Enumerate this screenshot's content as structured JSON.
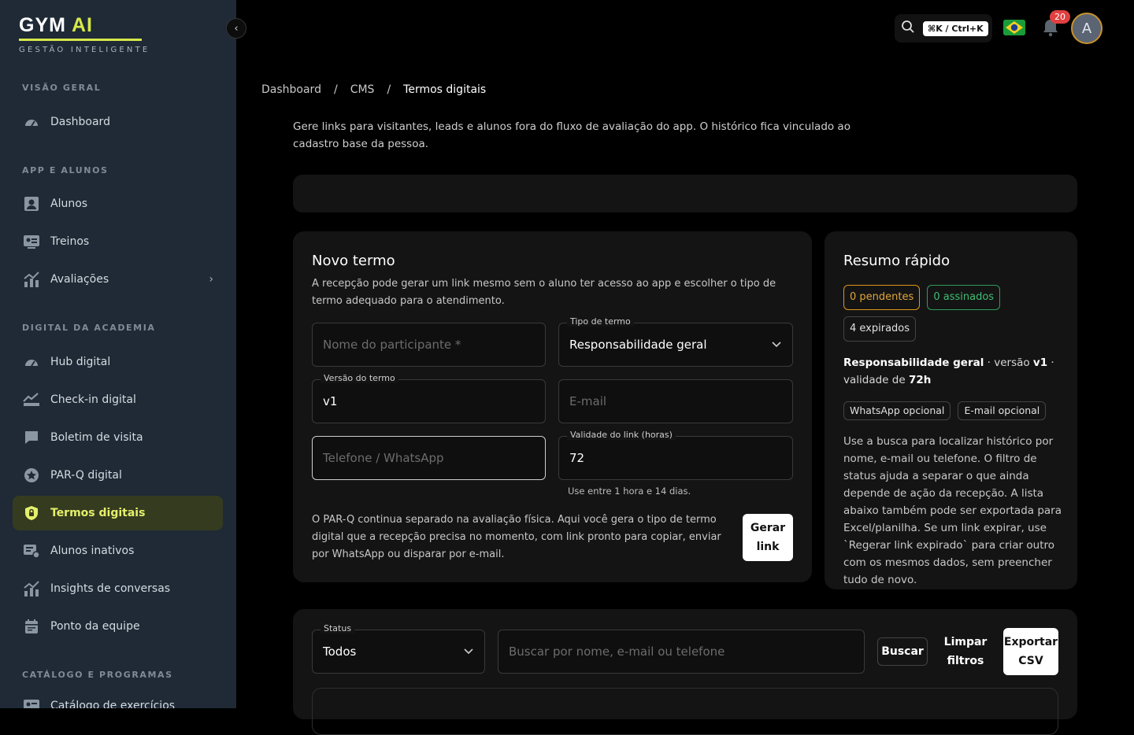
{
  "brand": {
    "name_main": "GYM",
    "name_accent": "AI",
    "tagline": "GESTÃO INTELIGENTE"
  },
  "sidebar": {
    "sections": [
      {
        "label": "VISÃO GERAL"
      },
      {
        "label": "APP E ALUNOS"
      },
      {
        "label": "DIGITAL DA ACADEMIA"
      },
      {
        "label": "CATÁLOGO E PROGRAMAS"
      }
    ],
    "items": [
      {
        "label": "Dashboard",
        "icon": "gauge-icon"
      },
      {
        "label": "Alunos",
        "icon": "user-icon"
      },
      {
        "label": "Treinos",
        "icon": "id-card-icon"
      },
      {
        "label": "Avaliações",
        "icon": "chart-icon"
      },
      {
        "label": "Hub digital",
        "icon": "gauge-icon"
      },
      {
        "label": "Check-in digital",
        "icon": "check-in-icon"
      },
      {
        "label": "Boletim de visita",
        "icon": "message-icon"
      },
      {
        "label": "PAR-Q digital",
        "icon": "star-badge-icon"
      },
      {
        "label": "Termos digitais",
        "icon": "lock-icon"
      },
      {
        "label": "Alunos inativos",
        "icon": "user-inactive-icon"
      },
      {
        "label": "Insights de conversas",
        "icon": "chart-icon"
      },
      {
        "label": "Ponto da equipe",
        "icon": "calendar-icon"
      },
      {
        "label": "Catálogo de exercícios",
        "icon": "id-card-icon"
      }
    ]
  },
  "topbar": {
    "shortcut": "⌘K / Ctrl+K",
    "notifications": "20",
    "avatar_initial": "A"
  },
  "breadcrumb": {
    "items": [
      "Dashboard",
      "CMS",
      "Termos digitais"
    ],
    "sep": "/"
  },
  "intro": "Gere links para visitantes, leads e alunos fora do fluxo de avaliação do app. O histórico fica vinculado ao cadastro base da pessoa.",
  "novo_termo": {
    "title": "Novo termo",
    "desc": "A recepção pode gerar um link mesmo sem o aluno ter acesso ao app e escolher o tipo de termo adequado para o atendimento.",
    "nome_placeholder": "Nome do participante *",
    "tipo_label": "Tipo de termo",
    "tipo_value": "Responsabilidade geral",
    "versao_label": "Versão do termo",
    "versao_value": "v1",
    "email_placeholder": "E-mail",
    "telefone_placeholder": "Telefone / WhatsApp",
    "validade_label": "Validade do link (horas)",
    "validade_value": "72",
    "validade_help": "Use entre 1 hora e 14 dias.",
    "note": "O PAR-Q continua separado na avaliação física. Aqui você gera o tipo de termo digital que a recepção precisa no momento, com link pronto para copiar, enviar por WhatsApp ou disparar por e-mail.",
    "gerar_label": "Gerar link"
  },
  "resumo": {
    "title": "Resumo rápido",
    "pendentes": "0 pendentes",
    "assinados": "0 assinados",
    "expirados": "4 expirados",
    "termo_name": "Responsabilidade geral",
    "versao_prefix": " · versão ",
    "versao": "v1",
    "validade_prefix": " · validade de ",
    "validade": "72h",
    "tag1": "WhatsApp opcional",
    "tag2": "E-mail opcional",
    "text": "Use a busca para localizar histórico por nome, e-mail ou telefone. O filtro de status ajuda a separar o que ainda depende de ação da recepção. A lista abaixo também pode ser exportada para Excel/planilha. Se um link expirar, use `Regerar link expirado` para criar outro com os mesmos dados, sem preencher tudo de novo."
  },
  "filters": {
    "status_label": "Status",
    "status_value": "Todos",
    "search_placeholder": "Buscar por nome, e-mail ou telefone",
    "buscar": "Buscar",
    "limpar": "Limpar filtros",
    "exportar": "Exportar CSV"
  },
  "colors": {
    "accent": "#d7e84a",
    "sidebar": "#1f2a36",
    "active_bg": "#353b1f",
    "pending": "#e0961a",
    "signed": "#2f9c5a"
  }
}
